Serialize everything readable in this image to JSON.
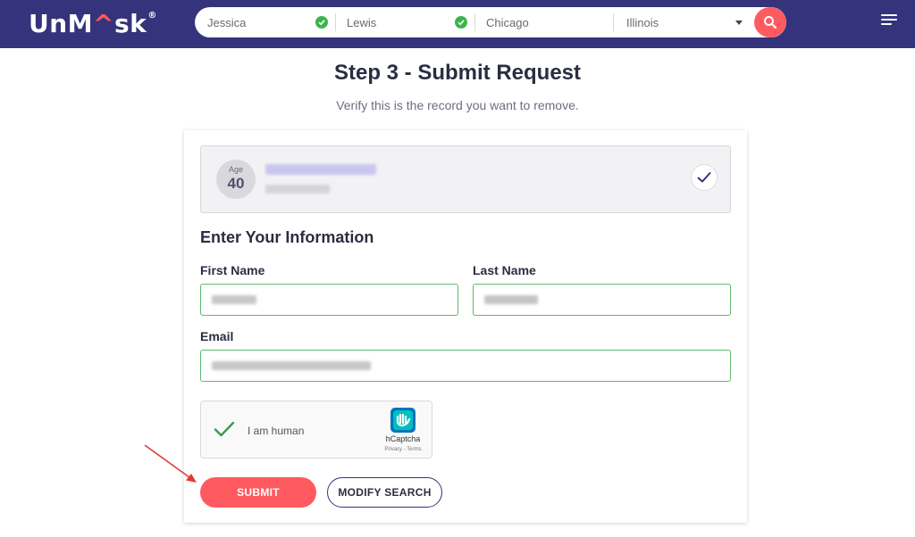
{
  "header": {
    "logo_main_1": "UnM",
    "logo_accent": "^",
    "logo_main_2": "sk",
    "logo_reg": "®",
    "search": {
      "first_name": "Jessica",
      "last_name": "Lewis",
      "city": "Chicago",
      "state": "Illinois"
    }
  },
  "page": {
    "title": "Step 3 - Submit Request",
    "subtitle": "Verify this is the record you want to remove."
  },
  "record": {
    "age_label": "Age",
    "age_value": "40"
  },
  "form": {
    "section_title": "Enter Your Information",
    "first_name_label": "First Name",
    "last_name_label": "Last Name",
    "email_label": "Email"
  },
  "captcha": {
    "text": "I am human",
    "brand": "hCaptcha",
    "links": "Privacy - Terms"
  },
  "buttons": {
    "submit": "SUBMIT",
    "modify": "MODIFY SEARCH"
  },
  "colors": {
    "header_bg": "#35337b",
    "accent": "#ff5a5f",
    "valid_green": "#3ab54a"
  }
}
